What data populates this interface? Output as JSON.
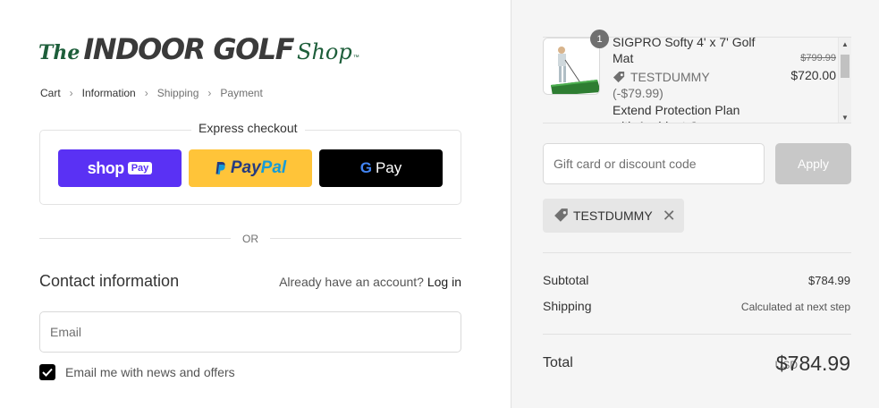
{
  "logo": {
    "the": "The",
    "main": "INDOOR GOLF",
    "shop": "Shop",
    "tm": "™"
  },
  "breadcrumb": [
    {
      "label": "Cart"
    },
    {
      "label": "Information"
    },
    {
      "label": "Shipping"
    },
    {
      "label": "Payment"
    }
  ],
  "express": {
    "title": "Express checkout",
    "shoppay": {
      "text": "shop",
      "pill": "Pay"
    },
    "paypal": {
      "pay1": "Pay",
      "pay2": "Pal"
    },
    "gpay": {
      "g": "G",
      "text": "Pay"
    }
  },
  "divider": {
    "or": "OR"
  },
  "contact": {
    "title": "Contact information",
    "account_prompt": "Already have an account?",
    "login": "Log in",
    "email_placeholder": "Email",
    "newsletter": "Email me with news and offers",
    "newsletter_checked": true
  },
  "order": {
    "item": {
      "quantity": "1",
      "name": "SIGPRO Softy 4' x 7' Golf Mat",
      "discount_code": "TESTDUMMY",
      "discount_amount": "(-$79.99)",
      "addon": "Extend Protection Plan with Accident Coverage",
      "price_old": "$799.99",
      "price_new": "$720.00"
    },
    "gift_placeholder": "Gift card or discount code",
    "apply_label": "Apply",
    "applied_code": "TESTDUMMY",
    "subtotal_label": "Subtotal",
    "subtotal": "$784.99",
    "shipping_label": "Shipping",
    "shipping": "Calculated at next step",
    "total_label": "Total",
    "currency": "USD",
    "total": "$784.99"
  },
  "colors": {
    "brand_green": "#1d5e3a",
    "shoppay": "#5a31f4",
    "paypal": "#ffc439",
    "gpay": "#000000"
  }
}
